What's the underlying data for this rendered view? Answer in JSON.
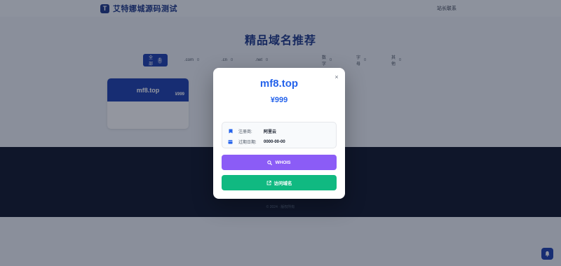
{
  "header": {
    "logo_mark": "T",
    "site_title": "艾特娜城源码测试",
    "nav_link": "站长联系"
  },
  "section": {
    "title": "精品域名推荐"
  },
  "tabs": [
    {
      "label": "全部",
      "count": "1",
      "active": true
    },
    {
      "label": ".com",
      "count": "0"
    },
    {
      "label": ".cn",
      "count": "0"
    },
    {
      "label": ".net",
      "count": "0"
    },
    {
      "label": "数字",
      "count": "0"
    },
    {
      "label": "字母",
      "count": "0"
    },
    {
      "label": "其他",
      "count": "0"
    }
  ],
  "card": {
    "domain": "mf8.top",
    "price": "¥999"
  },
  "footer": {
    "copyright": "© 2024 · 版权所有"
  },
  "modal": {
    "domain": "mf8.top",
    "price": "¥999",
    "registrar_label": "注册商:",
    "registrar_value": "阿里云",
    "expiry_label": "过期日期:",
    "expiry_value": "0000-00-00",
    "whois_label": "WHOIS",
    "visit_label": "访问域名",
    "close_glyph": "×"
  },
  "colors": {
    "brand": "#1e40af",
    "accent_blue": "#2563eb",
    "whois_purple": "#8b5cf6",
    "visit_green": "#10b981"
  }
}
